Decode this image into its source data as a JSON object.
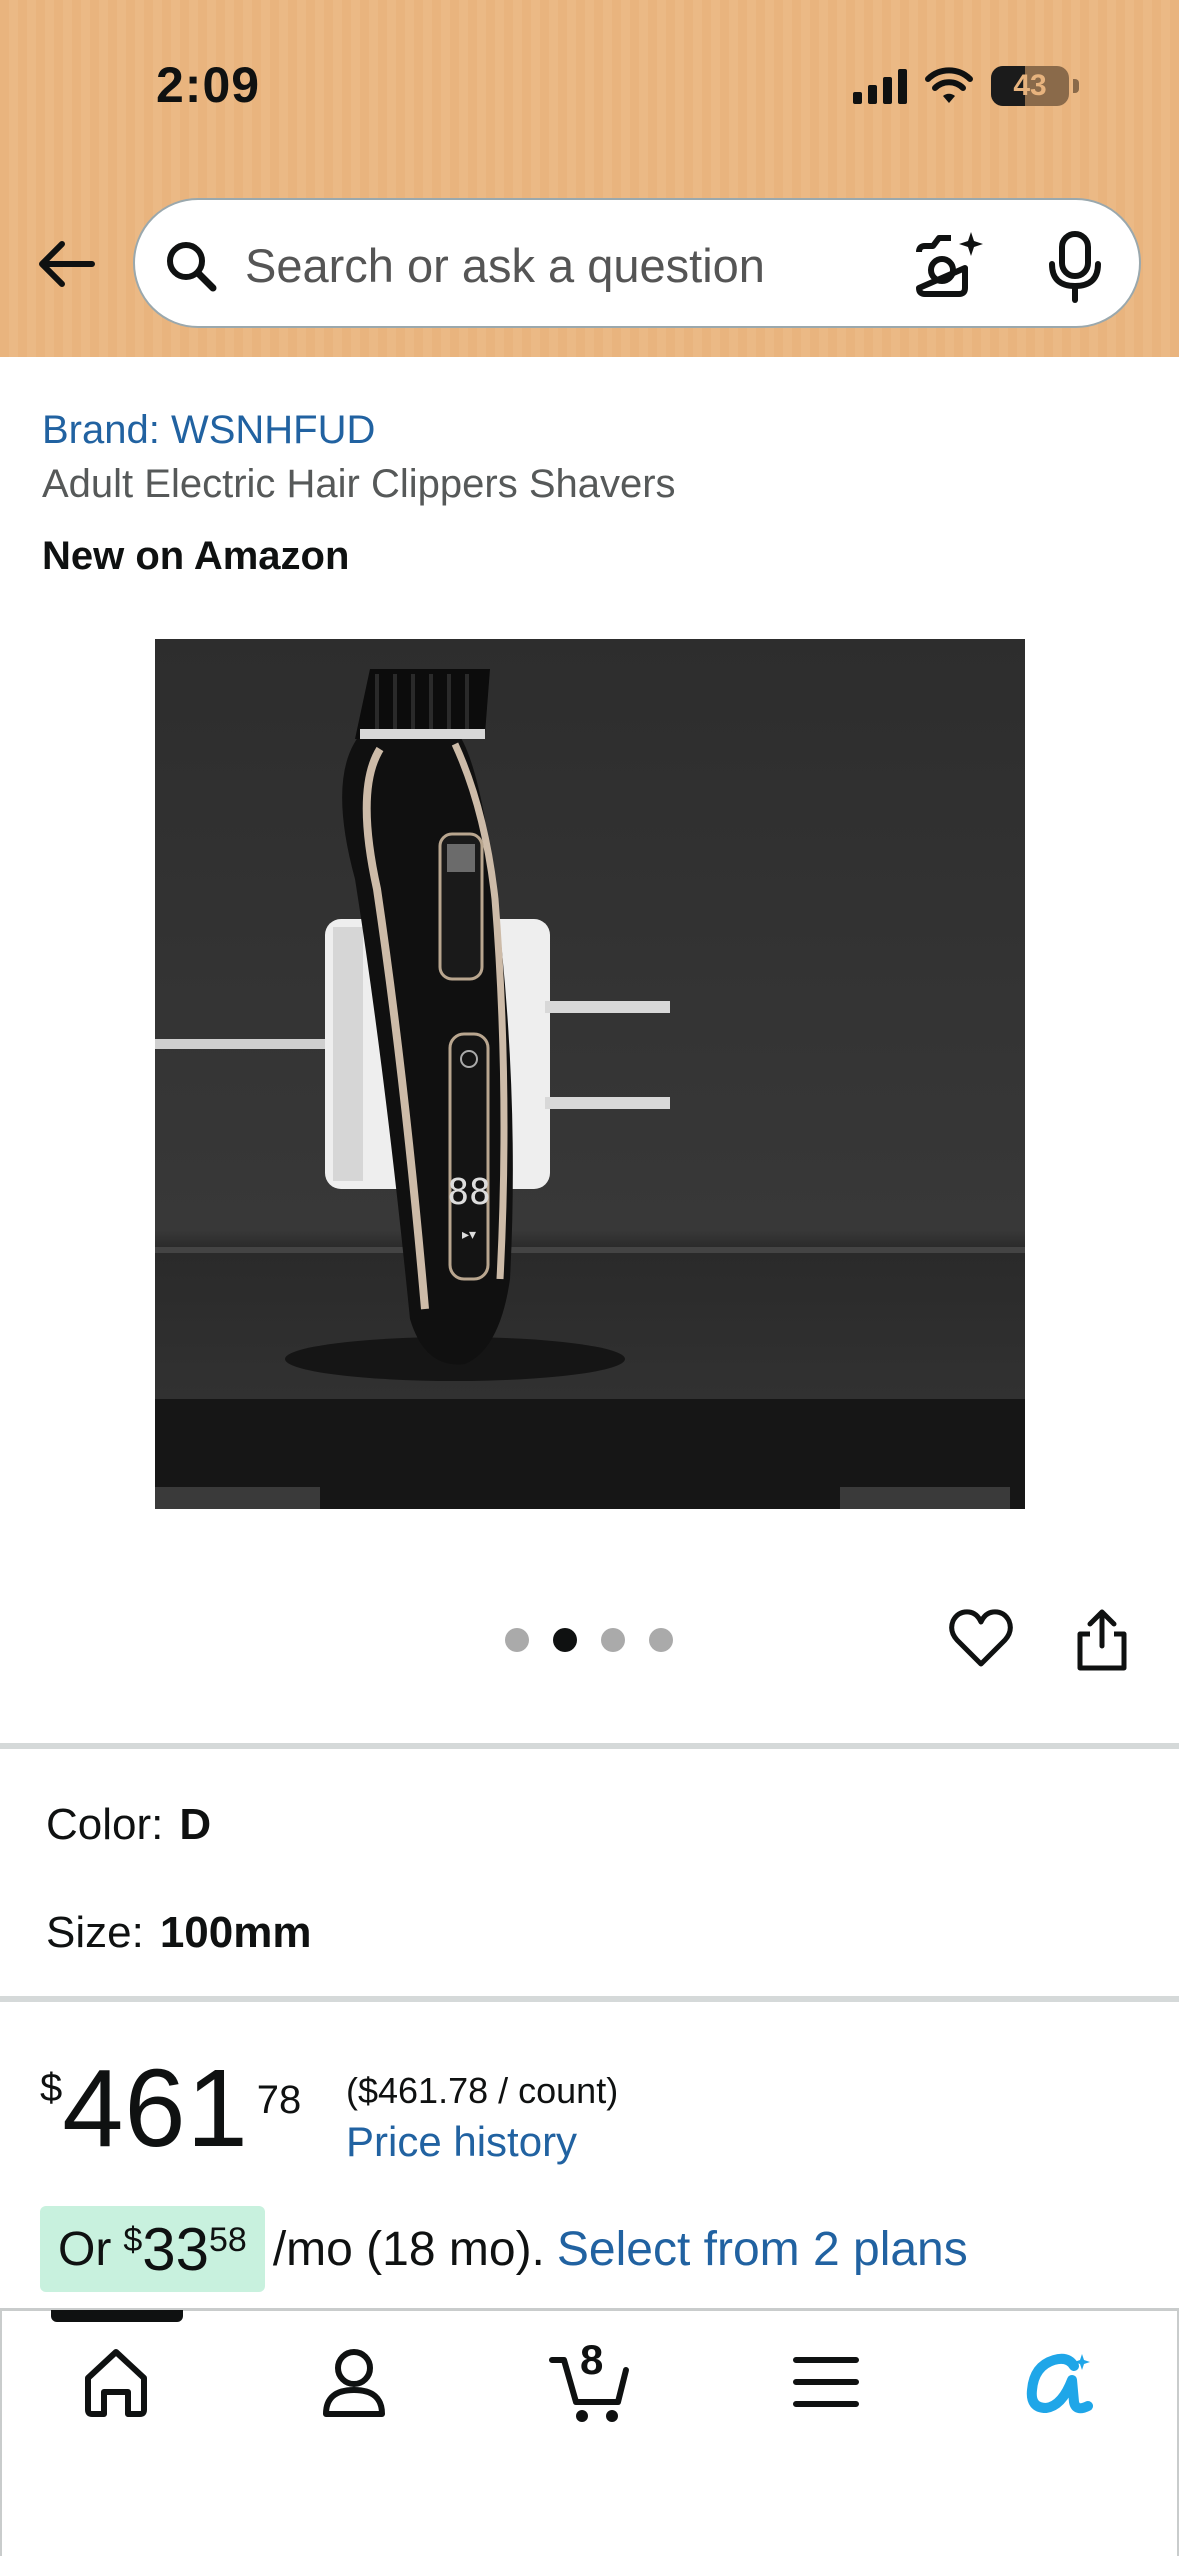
{
  "status_bar": {
    "time": "2:09",
    "battery": "43",
    "battery_level": 0.43
  },
  "search": {
    "placeholder": "Search or ask a question"
  },
  "product": {
    "brand": "Brand: WSNHFUD",
    "title": "Adult Electric Hair Clippers Shavers",
    "badge": "New on Amazon",
    "image_count": 4,
    "active_image": 2
  },
  "variations": {
    "color_label": "Color:",
    "color_value": "D",
    "size_label": "Size:",
    "size_value": "100mm"
  },
  "price": {
    "symbol": "$",
    "whole": "461",
    "fraction": "78",
    "unit_price": "($461.78 / count)",
    "history_link": "Price history"
  },
  "financing": {
    "prefix": "Or",
    "symbol": "$",
    "whole": "33",
    "fraction": "58",
    "terms": "/mo (18 mo).",
    "link": "Select from 2 plans"
  },
  "nav": {
    "cart_count": "8",
    "items": [
      "home-icon",
      "account-icon",
      "cart-icon",
      "menu-icon",
      "rufus-icon"
    ]
  },
  "colors": {
    "header": "#e9b47e",
    "link": "#2162a1",
    "financing_bg": "#c8f1de",
    "rufus": "#1fa6e8"
  }
}
